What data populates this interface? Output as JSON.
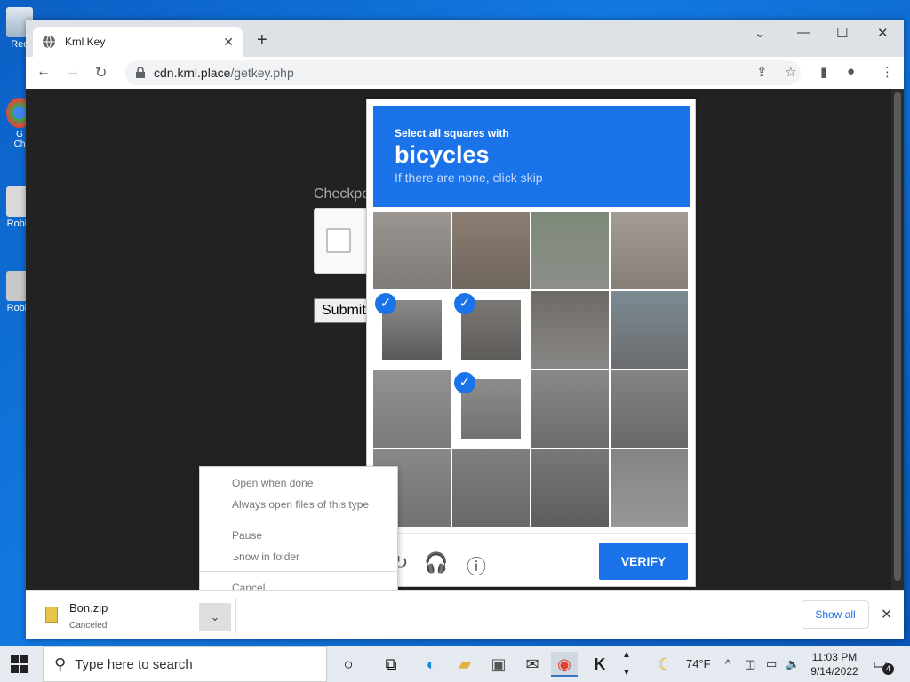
{
  "desktop": {
    "icons": [
      {
        "label": "Rec",
        "icon": "recycle-bin-icon"
      },
      {
        "label": "G\nCh",
        "icon": "chrome-shortcut-icon"
      },
      {
        "label": "Roblo",
        "icon": "roblox-shortcut-icon"
      },
      {
        "label": "Roblo",
        "icon": "roblox-studio-shortcut-icon"
      }
    ]
  },
  "browser": {
    "tab_title": "Krnl Key",
    "url_host": "cdn.krnl.place",
    "url_path": "/getkey.php"
  },
  "page": {
    "checkpoint_label": "Checkpo",
    "submit_label": "Submit"
  },
  "captcha": {
    "instruction": "Select all squares with",
    "target": "bicycles",
    "hint": "If there are none, click skip",
    "verify_label": "VERIFY",
    "selected_cells": [
      4,
      5,
      9
    ],
    "check_glyph": "✓"
  },
  "context_menu": {
    "items": [
      "Open when done",
      "Always open files of this type",
      "Pause",
      "Show in folder",
      "Cancel"
    ]
  },
  "download": {
    "file_name": "Bon.zip",
    "status": "Canceled",
    "show_all": "Show all"
  },
  "taskbar": {
    "search_placeholder": "Type here to search",
    "weather": "74°F",
    "time": "11:03 PM",
    "date": "9/14/2022",
    "notification_count": "4"
  },
  "colors": {
    "accent": "#1a73e8",
    "page_bg": "#222222"
  }
}
